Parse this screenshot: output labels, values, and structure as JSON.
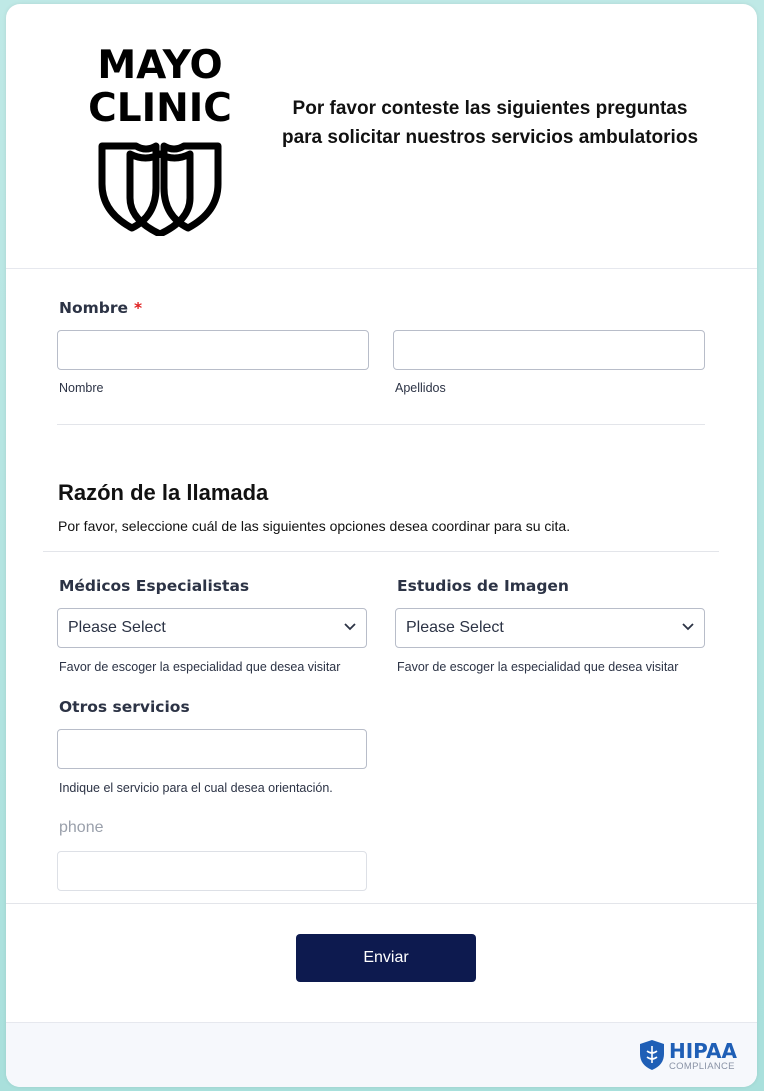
{
  "header": {
    "logo_line1": "MAYO",
    "logo_line2": "CLINIC",
    "title": "Por favor conteste las siguientes preguntas para solicitar nuestros servicios ambulatorios"
  },
  "name_field": {
    "label": "Nombre",
    "required_mark": "*",
    "first_sublabel": "Nombre",
    "first_value": "",
    "last_sublabel": "Apellidos",
    "last_value": ""
  },
  "reason": {
    "title": "Razón de la llamada",
    "description": "Por favor, seleccione cuál de las siguientes opciones desea coordinar para su cita."
  },
  "specialists": {
    "label": "Médicos Especialistas",
    "selected": "Please Select",
    "help": "Favor de escoger la especialidad que desea visitar"
  },
  "imaging": {
    "label": "Estudios de Imagen",
    "selected": "Please Select",
    "help": "Favor de escoger la especialidad que desea visitar"
  },
  "other_services": {
    "label": "Otros servicios",
    "value": "",
    "help": "Indique el servicio para el cual desea orientación."
  },
  "phone": {
    "label": "phone",
    "value": ""
  },
  "submit_label": "Enviar",
  "footer": {
    "badge_title": "HIPAA",
    "badge_sub": "COMPLIANCE"
  },
  "colors": {
    "submit_bg": "#0d1a4f",
    "required": "#e02020",
    "hipaa_blue": "#1f5fb6"
  }
}
